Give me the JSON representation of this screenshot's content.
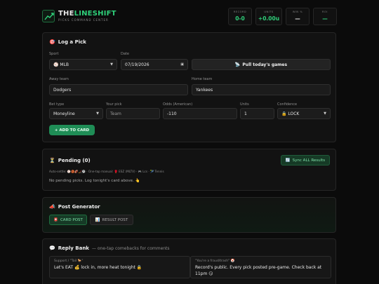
{
  "header": {
    "brand_part1": "THE",
    "brand_part2": "LINESHIFT",
    "subtitle": "PICKS COMMAND CENTER",
    "stats": [
      {
        "label": "RECORD",
        "value": "0-0",
        "green": true
      },
      {
        "label": "UNITS",
        "value": "+0.00u",
        "green": true
      },
      {
        "label": "WIN %",
        "value": "—",
        "green": false
      },
      {
        "label": "ROI",
        "value": "—",
        "green": true
      }
    ]
  },
  "log": {
    "title": "Log a Pick",
    "title_icon": "🎯",
    "sport_label": "Sport",
    "sport_value": "⚾ MLB",
    "date_label": "Date",
    "date_value": "07/19/2026",
    "pull_label": "Pull today's games",
    "pull_icon": "📡",
    "away_label": "Away team",
    "away_value": "Dodgers",
    "home_label": "Home team",
    "home_value": "Yankees",
    "bettype_label": "Bet type",
    "bettype_value": "Moneyline",
    "pick_label": "Your pick",
    "pick_placeholder": "Team",
    "odds_label": "Odds (American)",
    "odds_value": "-110",
    "units_label": "Units",
    "units_value": "1",
    "conf_label": "Confidence",
    "conf_value": "🔒 LOCK",
    "add_label": "+ ADD TO CARD"
  },
  "pending": {
    "title": "Pending (0)",
    "title_icon": "⏳",
    "sync_label": "Sync ALL Results",
    "sync_icon": "🔄",
    "settle_text": "Auto-settle: ⚾🏀🏈🏒⚽ · One-tap manual: 🥊 ESZ (MLTV) · 🎮 Lcs · 🎾 Tennis",
    "empty_text": "No pending picks. Log tonight's card above. 👆"
  },
  "postgen": {
    "title": "Post Generator",
    "title_icon": "📣",
    "tab_card": "CARD POST",
    "tab_card_icon": "📮",
    "tab_result": "RESULT POST",
    "tab_result_icon": "📊"
  },
  "reply": {
    "title": "Reply Bank",
    "title_icon": "💬",
    "subtitle": "— one-tap comebacks for comments",
    "cards": [
      {
        "tag": "Support / \"Tail 🐎\"",
        "text": "Let's EAT 💰 lock in, more heat tonight 🔒"
      },
      {
        "tag": "\"You're a fraud/trash\" 🤡",
        "text": "Record's public. Every pick posted pre-game. Check back at 11pm 😏"
      }
    ]
  }
}
